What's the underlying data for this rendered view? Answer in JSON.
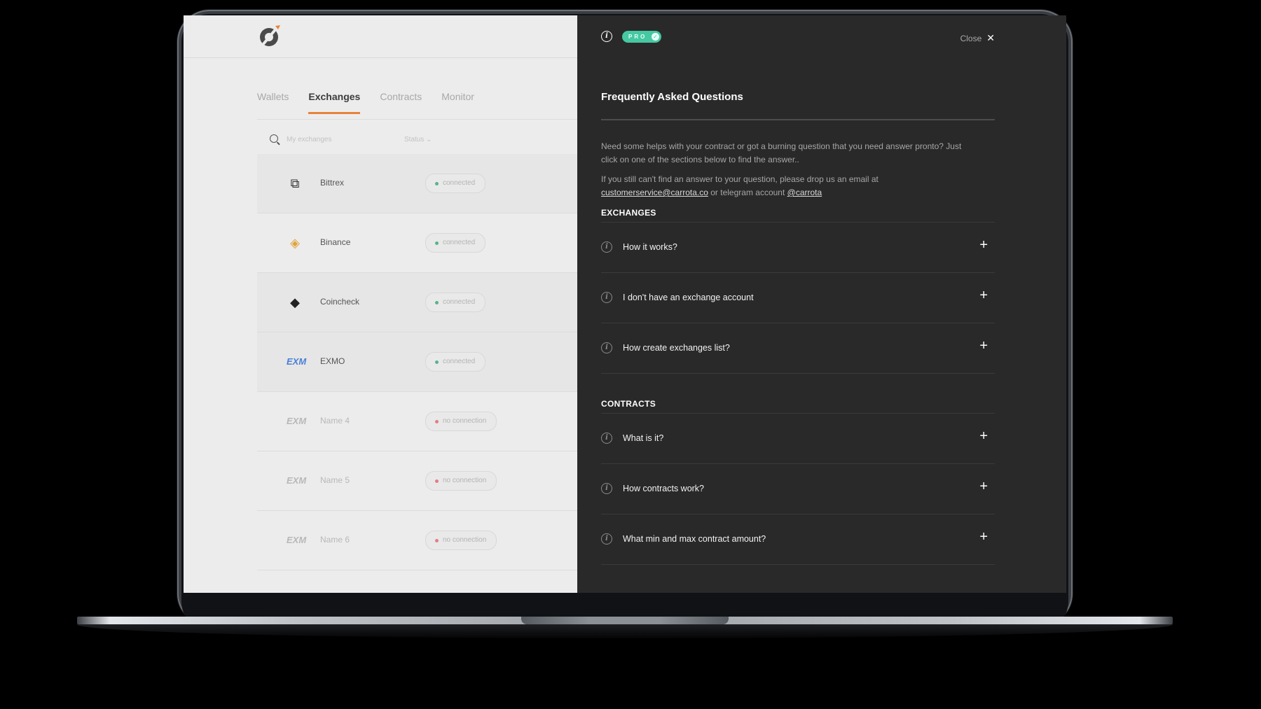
{
  "app": {
    "tabs": [
      "Wallets",
      "Exchanges",
      "Contracts",
      "Monitor"
    ],
    "active_tab": "Exchanges",
    "search_placeholder": "My exchanges",
    "status_filter": "Status",
    "exchanges": [
      {
        "name": "Bittrex",
        "status": "connected",
        "icon": "bittrex-icon"
      },
      {
        "name": "Binance",
        "status": "connected",
        "icon": "binance-icon"
      },
      {
        "name": "Coincheck",
        "status": "connected",
        "icon": "coincheck-icon"
      },
      {
        "name": "EXMO",
        "status": "connected",
        "icon": "exmo-icon"
      },
      {
        "name": "Name 4",
        "status": "no connection",
        "icon": "exmo-icon"
      },
      {
        "name": "Name 5",
        "status": "no connection",
        "icon": "exmo-icon"
      },
      {
        "name": "Name 6",
        "status": "no connection",
        "icon": "exmo-icon"
      }
    ]
  },
  "panel": {
    "badge": "PRO",
    "close_label": "Close",
    "title": "Frequently Asked Questions",
    "intro1": "Need some helps with your contract or got a burning question that you need answer pronto? Just click on one of the sections below to find the answer..",
    "intro2_a": "If you still can't find an answer to your question, please drop us an email at",
    "email": "customerservice@carrota.co",
    "intro2_b": "or telegram account",
    "telegram": "@carrota",
    "sections": [
      {
        "title": "EXCHANGES",
        "items": [
          "How it works?",
          "I don't have an exchange account",
          "How create exchanges list?"
        ]
      },
      {
        "title": "CONTRACTS",
        "items": [
          "What is it?",
          "How contracts work?",
          "What min and max contract amount?"
        ]
      }
    ]
  },
  "colors": {
    "accent": "#e8833a",
    "pro": "#46c8a2",
    "panel_bg": "#292929",
    "connected": "#5bb38b",
    "no_connection": "#e37e85"
  }
}
